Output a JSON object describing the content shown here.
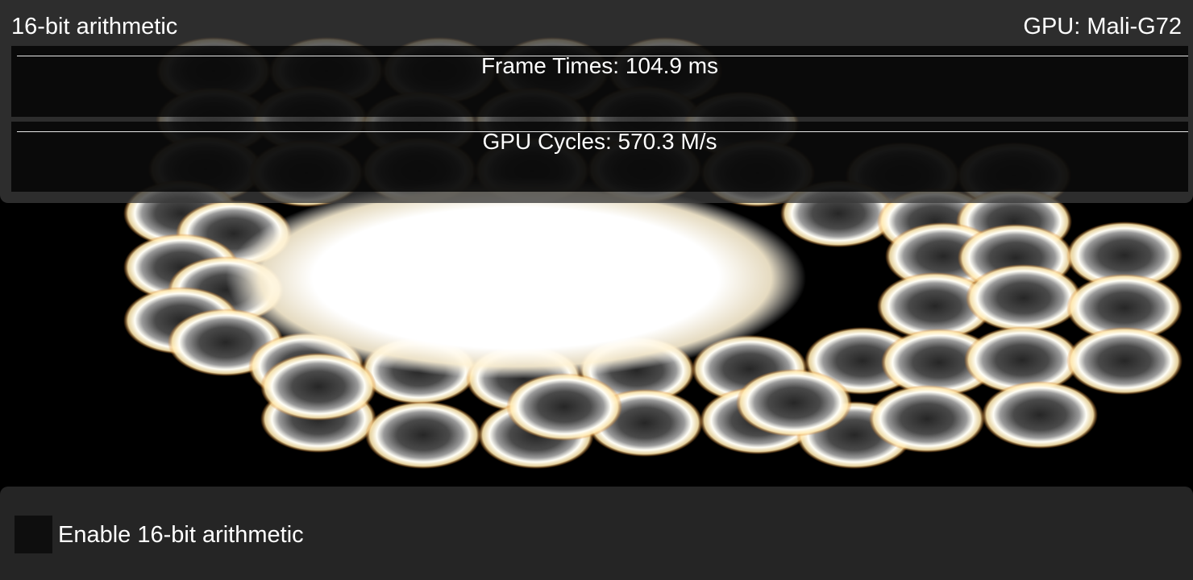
{
  "header": {
    "title": "16-bit arithmetic",
    "gpu_label": "GPU: Mali-G72"
  },
  "graphs": {
    "frame_times": "Frame Times: 104.9 ms",
    "gpu_cycles": "GPU Cycles: 570.3 M/s"
  },
  "options": {
    "enable_16bit_label": "Enable 16-bit arithmetic",
    "enable_16bit_checked": false
  },
  "colors": {
    "ring_glow": "#fff6d8",
    "ring_edge": "#e07a1a",
    "ring_center": "#2a2a2a",
    "panel_bg": "#3a3a3a",
    "graph_bg": "#000000"
  }
}
